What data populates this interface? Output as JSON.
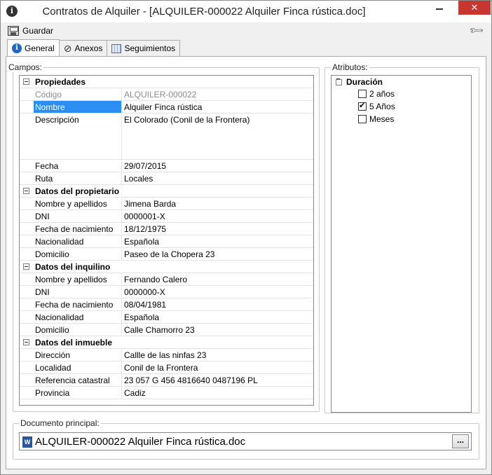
{
  "window": {
    "title": "Contratos de Alquiler - [ALQUILER-000022 Alquiler Finca  rústica.doc]",
    "app_icon": "i",
    "close_glyph": "✕"
  },
  "toolbar": {
    "save_label": "Guardar"
  },
  "tabs": [
    {
      "label": "General",
      "icon": "info-icon",
      "active": true
    },
    {
      "label": "Anexos",
      "icon": "paperclip-icon",
      "active": false
    },
    {
      "label": "Seguimientos",
      "icon": "calendar-icon",
      "active": false
    }
  ],
  "campos": {
    "legend": "Campos:",
    "propiedades": {
      "title": "Propiedades",
      "codigo": {
        "name": "Código",
        "value": "ALQUILER-000022"
      },
      "nombre": {
        "name": "Nombre",
        "value": "Alquiler Finca  rústica"
      },
      "descripcion": {
        "name": "Descripción",
        "value": "El Colorado (Conil de la Frontera)"
      },
      "fecha": {
        "name": "Fecha",
        "value": "29/07/2015"
      },
      "ruta": {
        "name": "Ruta",
        "value": "Locales"
      }
    },
    "propietario": {
      "title": "Datos del propietario",
      "nombre": {
        "name": "Nombre y apellidos",
        "value": "Jimena Barda"
      },
      "dni": {
        "name": "DNI",
        "value": "0000001-X"
      },
      "nacimiento": {
        "name": "Fecha de nacimiento",
        "value": "18/12/1975"
      },
      "nacionalidad": {
        "name": "Nacionalidad",
        "value": "Española"
      },
      "domicilio": {
        "name": "Domicilio",
        "value": "Paseo de la Chopera 23"
      }
    },
    "inquilino": {
      "title": "Datos del inquilino",
      "nombre": {
        "name": "Nombre y apellidos",
        "value": "Fernando Calero"
      },
      "dni": {
        "name": "DNI",
        "value": "0000000-X"
      },
      "nacimiento": {
        "name": "Fecha de nacimiento",
        "value": "08/04/1981"
      },
      "nacionalidad": {
        "name": "Nacionalidad",
        "value": "Española"
      },
      "domicilio": {
        "name": "Domicilio",
        "value": "Calle Chamorro 23"
      }
    },
    "inmueble": {
      "title": "Datos del inmueble",
      "direccion": {
        "name": "Dirección",
        "value": "Callle de las ninfas 23"
      },
      "localidad": {
        "name": "Localidad",
        "value": "Conil de la Frontera"
      },
      "catastral": {
        "name": "Referencia catastral",
        "value": "23 057 G 456 4816640 0487196 PL"
      },
      "provincia": {
        "name": "Provincia",
        "value": "Cadiz"
      }
    }
  },
  "atributos": {
    "legend": "Atributos:",
    "category": "Duración",
    "options": [
      {
        "label": "2 años",
        "checked": false
      },
      {
        "label": "5 Años",
        "checked": true
      },
      {
        "label": "Meses",
        "checked": false
      }
    ]
  },
  "documento": {
    "legend": "Documento principal:",
    "file_name": "ALQUILER-000022 Alquiler Finca  rústica.doc",
    "file_icon": "W",
    "browse_label": "..."
  }
}
